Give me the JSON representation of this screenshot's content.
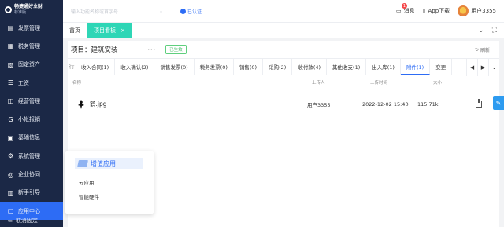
{
  "brand": {
    "name": "畅捷通好业财",
    "sub": "标准版"
  },
  "sidebar": {
    "items": [
      {
        "label": "发票管理",
        "icon": "invoice-icon"
      },
      {
        "label": "税务管理",
        "icon": "tax-icon"
      },
      {
        "label": "固定资产",
        "icon": "asset-icon"
      },
      {
        "label": "工资",
        "icon": "salary-icon"
      },
      {
        "label": "经营管理",
        "icon": "business-icon"
      },
      {
        "label": "小帐报销",
        "icon": "expense-icon"
      },
      {
        "label": "基础信息",
        "icon": "info-icon"
      },
      {
        "label": "系统管理",
        "icon": "system-icon"
      },
      {
        "label": "企业协同",
        "icon": "collab-icon"
      },
      {
        "label": "新手引导",
        "icon": "guide-icon"
      },
      {
        "label": "应用中心",
        "icon": "app-center-icon",
        "active": true
      }
    ],
    "footer": "取消固定"
  },
  "topbar": {
    "search_placeholder": "输入功能名称或首字母",
    "auth_label": "已认证",
    "msg_label": "消息",
    "msg_count": "1",
    "app_label": "App下载",
    "user_label": "用户3355"
  },
  "tabs": {
    "home": "首页",
    "active": "项目看板",
    "close": "×"
  },
  "project": {
    "title": "项目：建筑安装",
    "status": "已生效",
    "refresh": "刷新"
  },
  "subtabs": [
    "行",
    "收入合同(1)",
    "收入确认(2)",
    "销售发票(0)",
    "税务发票(0)",
    "销售(0)",
    "采购(2)",
    "收付款(4)",
    "其他收支(1)",
    "出入库(1)",
    "附件(1)",
    "变更"
  ],
  "subtab_active_index": 10,
  "table": {
    "columns": {
      "name": "名称",
      "uploader": "上传人",
      "time": "上传时间",
      "size": "大小"
    },
    "rows": [
      {
        "name": "鹤.jpg",
        "uploader": "用户3355",
        "time": "2022-12-02 15:40",
        "size": "115.71k"
      }
    ]
  },
  "popup": {
    "title": "增值应用",
    "items": [
      "云应用",
      "智能硬件"
    ]
  },
  "colors": {
    "sidebar": "#1b2846",
    "accent": "#2d6cf5",
    "tab_active": "#2ed6b6",
    "status": "#3bb85f"
  }
}
